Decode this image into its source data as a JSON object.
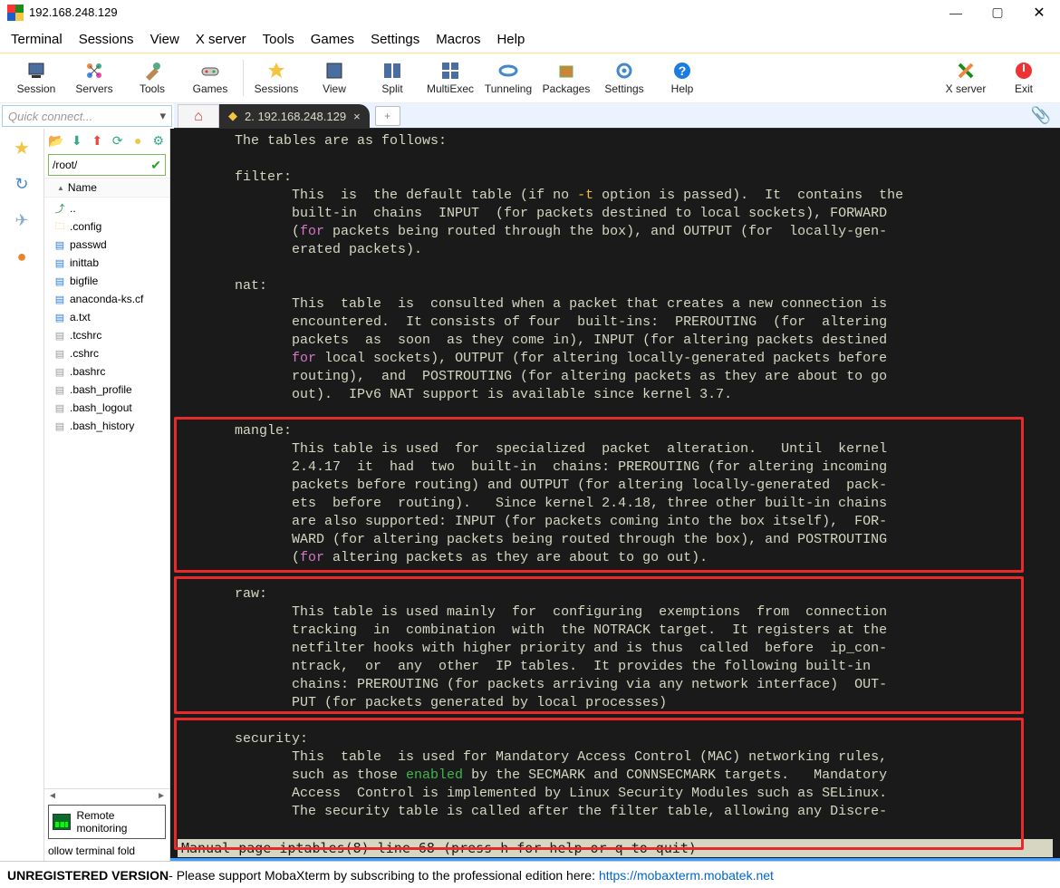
{
  "title": "192.168.248.129",
  "win": {
    "min": "—",
    "max": "▢",
    "close": "✕"
  },
  "menu": [
    "Terminal",
    "Sessions",
    "View",
    "X server",
    "Tools",
    "Games",
    "Settings",
    "Macros",
    "Help"
  ],
  "toolbar": [
    {
      "label": "Session"
    },
    {
      "label": "Servers"
    },
    {
      "label": "Tools"
    },
    {
      "label": "Games"
    },
    {
      "label": "Sessions"
    },
    {
      "label": "View"
    },
    {
      "label": "Split"
    },
    {
      "label": "MultiExec"
    },
    {
      "label": "Tunneling"
    },
    {
      "label": "Packages"
    },
    {
      "label": "Settings"
    },
    {
      "label": "Help"
    }
  ],
  "toolbar_right": [
    {
      "label": "X server"
    },
    {
      "label": "Exit"
    }
  ],
  "quick_connect_placeholder": "Quick connect...",
  "tab_home_icon": "⌂",
  "tab_active": {
    "icon": "◆",
    "label": "2. 192.168.248.129",
    "close": "×"
  },
  "tab_plus": "+",
  "attach": "📎",
  "sidebar": {
    "path": "/root/",
    "name_header": "Name",
    "files": [
      {
        "t": "up",
        "name": ".."
      },
      {
        "t": "folder",
        "name": ".config"
      },
      {
        "t": "page",
        "name": "passwd"
      },
      {
        "t": "page",
        "name": "inittab"
      },
      {
        "t": "page",
        "name": "bigfile"
      },
      {
        "t": "page",
        "name": "anaconda-ks.cf"
      },
      {
        "t": "page",
        "name": "a.txt"
      },
      {
        "t": "file",
        "name": ".tcshrc"
      },
      {
        "t": "file",
        "name": ".cshrc"
      },
      {
        "t": "file",
        "name": ".bashrc"
      },
      {
        "t": "file",
        "name": ".bash_profile"
      },
      {
        "t": "file",
        "name": ".bash_logout"
      },
      {
        "t": "file",
        "name": ".bash_history"
      }
    ],
    "remote": "Remote monitoring",
    "follow": "ollow terminal fold"
  },
  "term": {
    "tables_hdr": "       The tables are as follows:",
    "filter_hdr": "       filter:",
    "filter_l1a": "              This  is  the default table (if no ",
    "filter_opt": "-t",
    "filter_l1b": " option is passed).  It  contains  the",
    "filter_l2": "              built-in  chains  INPUT  (for packets destined to local sockets), FORWARD",
    "filter_l3a": "              (",
    "filter_for": "for",
    "filter_l3b": " packets being routed through the box), and OUTPUT (for  locally-gen-",
    "filter_l4": "              erated packets).",
    "nat_hdr": "       nat:",
    "nat_l1": "              This  table  is  consulted when a packet that creates a new connection is",
    "nat_l2": "              encountered.  It consists of four  built-ins:  PREROUTING  (for  altering",
    "nat_l3": "              packets  as  soon  as they come in), INPUT (for altering packets destined",
    "nat_l4a": "              ",
    "nat_for": "for",
    "nat_l4b": " local sockets), OUTPUT (for altering locally-generated packets before",
    "nat_l5": "              routing),  and  POSTROUTING (for altering packets as they are about to go",
    "nat_l6": "              out).  IPv6 NAT support is available since kernel 3.7.",
    "mangle_hdr": "       mangle:",
    "mangle_l1": "              This table is used  for  specialized  packet  alteration.   Until  kernel",
    "mangle_l2": "              2.4.17  it  had  two  built-in  chains: PREROUTING (for altering incoming",
    "mangle_l3": "              packets before routing) and OUTPUT (for altering locally-generated  pack-",
    "mangle_l4": "              ets  before  routing).   Since kernel 2.4.18, three other built-in chains",
    "mangle_l5": "              are also supported: INPUT (for packets coming into the box itself),  FOR-",
    "mangle_l6": "              WARD (for altering packets being routed through the box), and POSTROUTING",
    "mangle_l7a": "              (",
    "mangle_for": "for",
    "mangle_l7b": " altering packets as they are about to go out).",
    "raw_hdr": "       raw:",
    "raw_l1": "              This table is used mainly  for  configuring  exemptions  from  connection",
    "raw_l2": "              tracking  in  combination  with  the NOTRACK target.  It registers at the",
    "raw_l3": "              netfilter hooks with higher priority and is thus  called  before  ip_con-",
    "raw_l4": "              ntrack,  or  any  other  IP tables.  It provides the following built-in",
    "raw_l5": "              chains: PREROUTING (for packets arriving via any network interface)  OUT-",
    "raw_l6": "              PUT (for packets generated by local processes)",
    "sec_hdr": "       security:",
    "sec_l1": "              This  table  is used for Mandatory Access Control (MAC) networking rules,",
    "sec_l2a": "              such as those ",
    "sec_en": "enabled",
    "sec_l2b": " by the SECMARK and CONNSECMARK targets.   Mandatory",
    "sec_l3": "              Access  Control is implemented by Linux Security Modules such as SELinux.",
    "sec_l4": "              The security table is called after the filter table, allowing any Discre-",
    "status": " Manual page iptables(8) line 68 (press h for help or q to quit)"
  },
  "footer": {
    "unreg": "UNREGISTERED VERSION",
    "msg": "  -  Please support MobaXterm by subscribing to the professional edition here:  ",
    "link": "https://mobaxterm.mobatek.net"
  }
}
